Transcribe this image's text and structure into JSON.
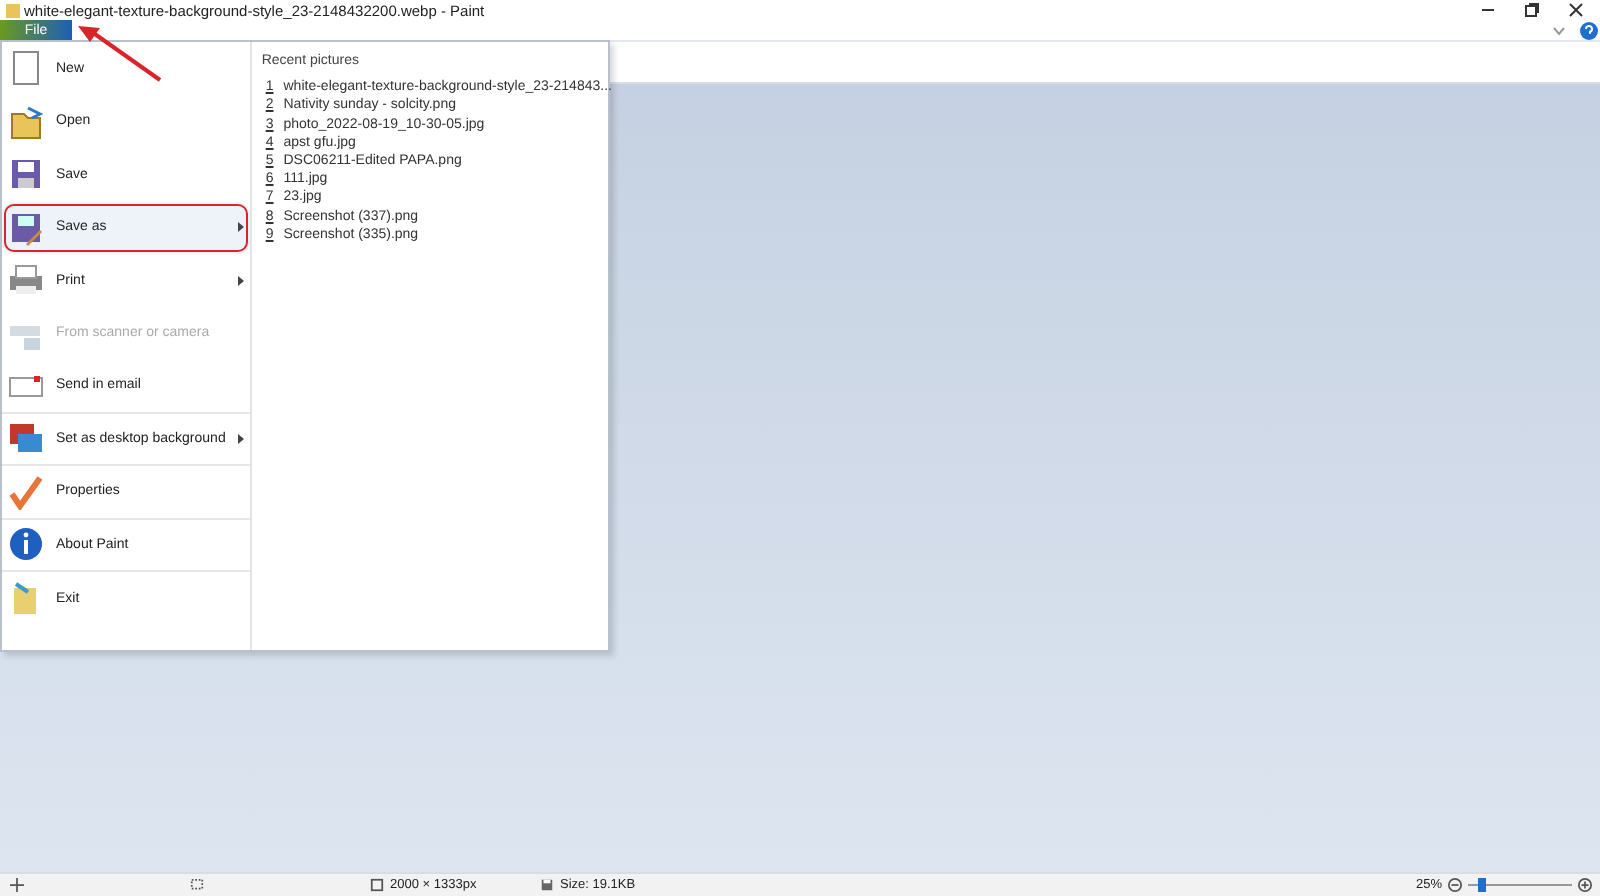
{
  "window": {
    "title": "white-elegant-texture-background-style_23-2148432200.webp - Paint"
  },
  "file_tab": {
    "label": "File",
    "selected": true
  },
  "file_menu": {
    "items": [
      {
        "label": "New",
        "submenu": false,
        "disabled": false,
        "highlighted": false,
        "divider_after": false
      },
      {
        "label": "Open",
        "submenu": false,
        "disabled": false,
        "highlighted": false,
        "divider_after": false
      },
      {
        "label": "Save",
        "submenu": false,
        "disabled": false,
        "highlighted": false,
        "divider_after": false
      },
      {
        "label": "Save as",
        "submenu": true,
        "disabled": false,
        "highlighted": true,
        "divider_after": false
      },
      {
        "label": "Print",
        "submenu": true,
        "disabled": false,
        "highlighted": false,
        "divider_after": false
      },
      {
        "label": "From scanner or camera",
        "submenu": false,
        "disabled": true,
        "highlighted": false,
        "divider_after": false
      },
      {
        "label": "Send in email",
        "submenu": false,
        "disabled": false,
        "highlighted": false,
        "divider_after": true
      },
      {
        "label": "Set as desktop background",
        "submenu": true,
        "disabled": false,
        "highlighted": false,
        "divider_after": true
      },
      {
        "label": "Properties",
        "submenu": false,
        "disabled": false,
        "highlighted": false,
        "divider_after": true
      },
      {
        "label": "About Paint",
        "submenu": false,
        "disabled": false,
        "highlighted": false,
        "divider_after": true
      },
      {
        "label": "Exit",
        "submenu": false,
        "disabled": false,
        "highlighted": false,
        "divider_after": false
      }
    ],
    "recent_title": "Recent pictures",
    "recent": [
      {
        "index": "1",
        "name": "white-elegant-texture-background-style_23-214843..."
      },
      {
        "index": "2",
        "name": "Nativity sunday - solcity.png"
      },
      {
        "index": "3",
        "name": "photo_2022-08-19_10-30-05.jpg"
      },
      {
        "index": "4",
        "name": "apst gfu.jpg"
      },
      {
        "index": "5",
        "name": "DSC06211-Edited  PAPA.png"
      },
      {
        "index": "6",
        "name": "111.jpg"
      },
      {
        "index": "7",
        "name": "23.jpg"
      },
      {
        "index": "8",
        "name": "Screenshot (337).png"
      },
      {
        "index": "9",
        "name": "Screenshot (335).png"
      }
    ]
  },
  "status_bar": {
    "dimensions": "2000 × 1333px",
    "size": "Size: 19.1KB",
    "zoom": "25%",
    "zoom_slider": {
      "level": 0.1
    }
  }
}
